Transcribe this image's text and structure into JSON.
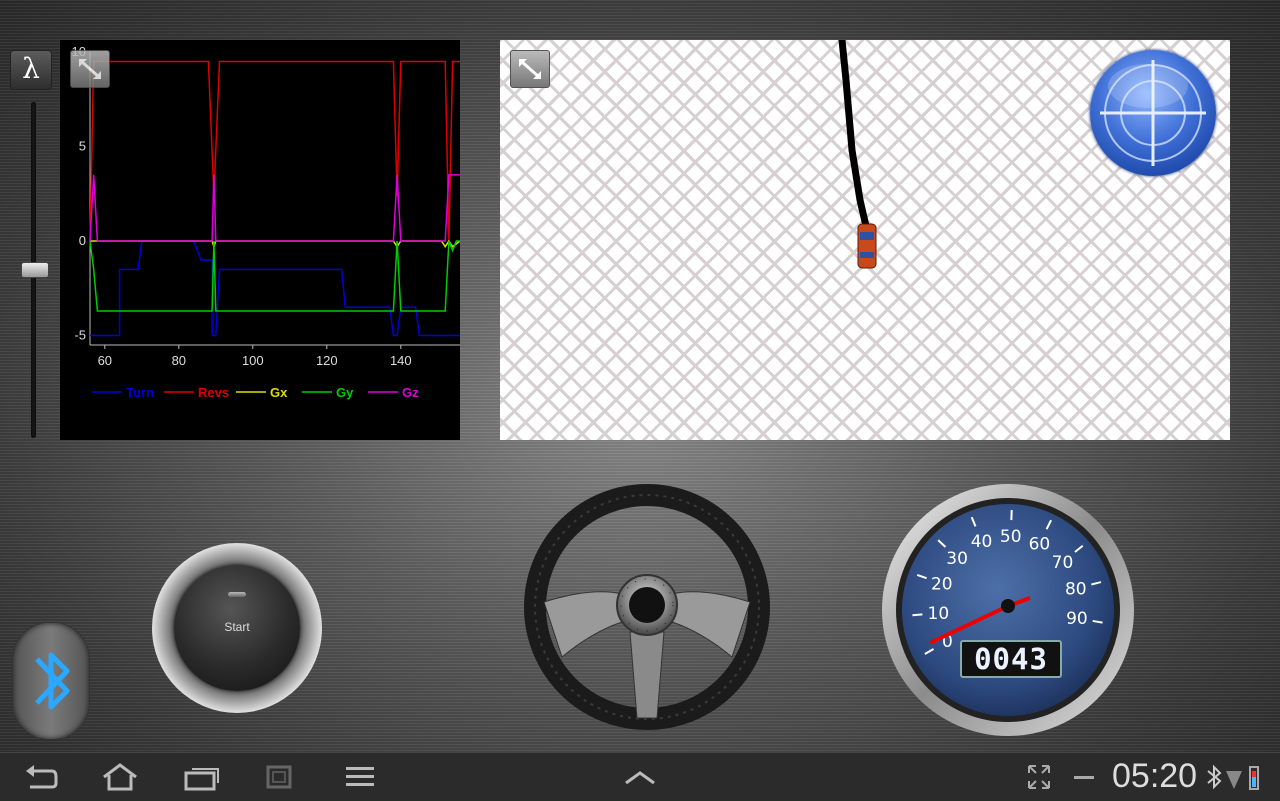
{
  "toolbar": {
    "lambda_label": "λ",
    "slider_level": 0.5
  },
  "chart_data": {
    "type": "line",
    "xlim": [
      56,
      156
    ],
    "ylim": [
      -5.5,
      10
    ],
    "x_ticks": [
      "60",
      "80",
      "100",
      "120",
      "140"
    ],
    "y_ticks": [
      "10",
      "5",
      "0",
      "-5"
    ],
    "grid": false,
    "legend_placement": "bottom",
    "series": [
      {
        "name": "Turn",
        "color": "#0000dd",
        "x": [
          56,
          64,
          64,
          69,
          70,
          84,
          86,
          89,
          89,
          90,
          91,
          92,
          112,
          113,
          124,
          125,
          137,
          138,
          139,
          140,
          144,
          145,
          156
        ],
        "y": [
          -5,
          -5,
          -1.5,
          -1.5,
          0,
          0,
          -1,
          -1,
          -5,
          -5,
          -1.5,
          -1.5,
          -1.5,
          -1.5,
          -1.5,
          -3.5,
          -3.5,
          -5,
          -5,
          -3.5,
          -3.5,
          -5,
          -5
        ]
      },
      {
        "name": "Revs",
        "color": "#dd0000",
        "x": [
          56,
          57,
          59,
          88,
          89.5,
          91,
          138,
          139,
          140,
          152,
          153,
          154,
          156
        ],
        "y": [
          0,
          9.5,
          9.5,
          9.5,
          2.4,
          9.5,
          9.5,
          2.4,
          9.5,
          9.5,
          0,
          9.5,
          9.5
        ]
      },
      {
        "name": "Gx",
        "color": "#dddd00",
        "x": [
          56,
          89,
          89.5,
          90,
          138,
          139,
          140,
          151,
          152,
          153,
          154,
          156
        ],
        "y": [
          0,
          0,
          -0.3,
          0,
          0,
          -0.3,
          0,
          0,
          -0.3,
          0,
          -0.3,
          0
        ]
      },
      {
        "name": "Gy",
        "color": "#00cc00",
        "x": [
          56,
          57,
          58,
          89,
          89.5,
          90,
          138,
          139,
          140,
          152,
          153,
          154,
          155,
          156
        ],
        "y": [
          0,
          -1.5,
          -3.7,
          -3.7,
          0,
          -3.7,
          -3.7,
          0,
          -3.7,
          -3.7,
          0,
          -0.5,
          0,
          0
        ]
      },
      {
        "name": "Gz",
        "color": "#dd00dd",
        "x": [
          56,
          57,
          58,
          89,
          89.5,
          90,
          138,
          139,
          140,
          152,
          153,
          154,
          156
        ],
        "y": [
          0,
          3.5,
          0,
          0,
          3.5,
          0,
          0,
          3.5,
          0,
          0,
          3.5,
          3.5,
          3.5
        ]
      }
    ]
  },
  "map": {
    "target_icon": "crosshair-icon",
    "car_icon": "car-icon"
  },
  "controls": {
    "start_label": "Start",
    "bluetooth_icon": "bluetooth-icon",
    "speedometer": {
      "ticks": [
        "0",
        "10",
        "20",
        "30",
        "40",
        "50",
        "60",
        "70",
        "80",
        "90"
      ],
      "odometer": "0043"
    }
  },
  "statusbar": {
    "time": "05:20",
    "accent": "#4fb3ff"
  }
}
